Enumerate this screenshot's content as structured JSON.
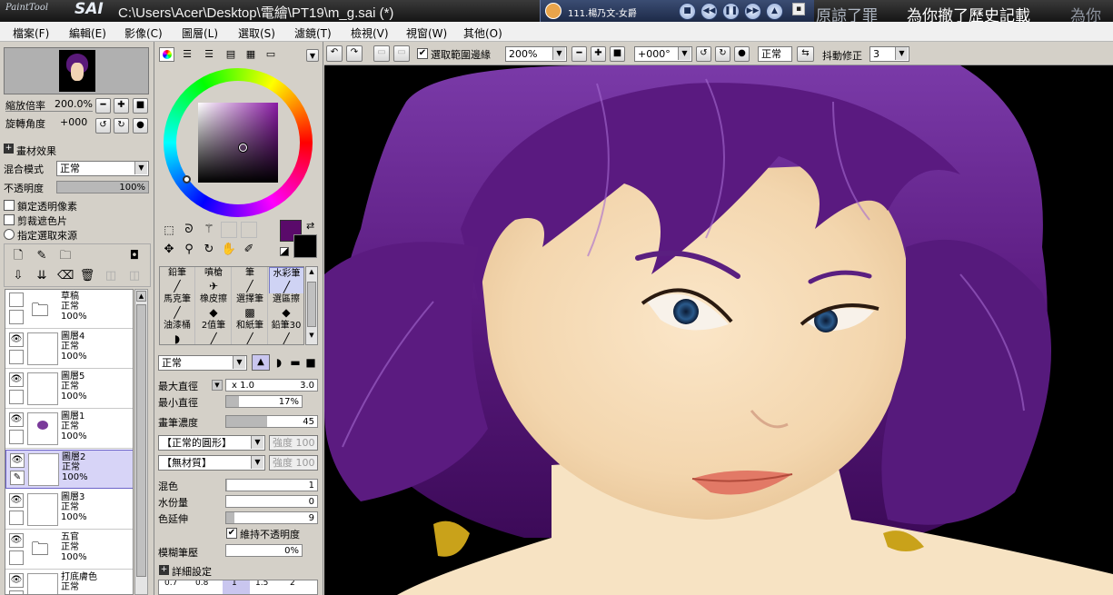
{
  "window": {
    "logo_small": "PaintTool",
    "logo_big": "SAI",
    "title": "C:\\Users\\Acer\\Desktop\\電繪\\PT19\\m_g.sai (*)"
  },
  "player": {
    "song": "111.楊乃文-女爵",
    "lyrics_fade": "原諒了罪",
    "lyrics_current": "為你撤了歷史記載",
    "lyrics_next": "為你"
  },
  "menu": [
    "檔案(F)",
    "編輯(E)",
    "影像(C)",
    "圖層(L)",
    "選取(S)",
    "濾鏡(T)",
    "檢視(V)",
    "視窗(W)",
    "其他(O)"
  ],
  "navigator": {
    "zoom_label": "縮放倍率",
    "zoom_value": "200.0%",
    "rotate_label": "旋轉角度",
    "rotate_value": "+000"
  },
  "layer_props": {
    "texture_label": "畫材效果",
    "blend_label": "混合模式",
    "blend_value": "正常",
    "opacity_label": "不透明度",
    "opacity_value": "100%",
    "opacity_level": 1.0,
    "lock_alpha": "鎖定透明像素",
    "clip_group": "剪裁遮色片",
    "selection_source": "指定選取來源"
  },
  "layers": [
    {
      "name": "草稿",
      "mode": "正常",
      "opacity": "100%",
      "folder": true,
      "visible": false,
      "selected": false
    },
    {
      "name": "圖層4",
      "mode": "正常",
      "opacity": "100%",
      "folder": false,
      "visible": true,
      "selected": false
    },
    {
      "name": "圖層5",
      "mode": "正常",
      "opacity": "100%",
      "folder": false,
      "visible": true,
      "selected": false
    },
    {
      "name": "圖層1",
      "mode": "正常",
      "opacity": "100%",
      "folder": false,
      "visible": true,
      "selected": false
    },
    {
      "name": "圖層2",
      "mode": "正常",
      "opacity": "100%",
      "folder": false,
      "visible": true,
      "selected": true
    },
    {
      "name": "圖層3",
      "mode": "正常",
      "opacity": "100%",
      "folder": false,
      "visible": true,
      "selected": false
    },
    {
      "name": "五官",
      "mode": "正常",
      "opacity": "100%",
      "folder": true,
      "visible": true,
      "selected": false
    },
    {
      "name": "打底膚色",
      "mode": "正常",
      "opacity": "",
      "folder": false,
      "visible": true,
      "selected": false
    }
  ],
  "colors": {
    "primary": "#5a0a6a",
    "secondary": "#000000",
    "hair": "#5b1b80",
    "skin": "#f6dcb8"
  },
  "brushes": [
    [
      "鉛筆",
      "噴槍",
      "筆",
      "水彩筆"
    ],
    [
      "馬克筆",
      "橡皮擦",
      "選擇筆",
      "選區擦"
    ],
    [
      "油漆桶",
      "2值筆",
      "和紙筆",
      "鉛筆30"
    ]
  ],
  "brush_settings": {
    "mode": "正常",
    "max_size_label": "最大直徑",
    "max_size_mult": "x 1.0",
    "max_size_value": "3.0",
    "min_size_label": "最小直徑",
    "min_size_value": "17%",
    "min_size_level": 0.17,
    "density_label": "畫筆濃度",
    "density_value": "45",
    "density_level": 0.45,
    "shape": "【正常的圓形】",
    "shape_strength": "強度 100",
    "texture": "【無材質】",
    "texture_strength": "強度 100",
    "blend_label": "混色",
    "blend_value": "1",
    "blend_level": 0.01,
    "water_label": "水份量",
    "water_value": "0",
    "water_level": 0.0,
    "stretch_label": "色延伸",
    "stretch_value": "9",
    "stretch_level": 0.09,
    "keep_opacity": "維持不透明度",
    "blur_label": "模糊筆壓",
    "blur_value": "0%",
    "blur_level": 0.0,
    "detail_label": "詳細設定",
    "size_ticks": [
      "0.7",
      "0.8",
      "1",
      "1.5",
      "2"
    ]
  },
  "canvas_toolbar": {
    "selection_edge": "選取範圍邊緣",
    "zoom": "200%",
    "angle": "+000°",
    "mode": "正常",
    "stabilizer_label": "抖動修正",
    "stabilizer_value": "3"
  }
}
